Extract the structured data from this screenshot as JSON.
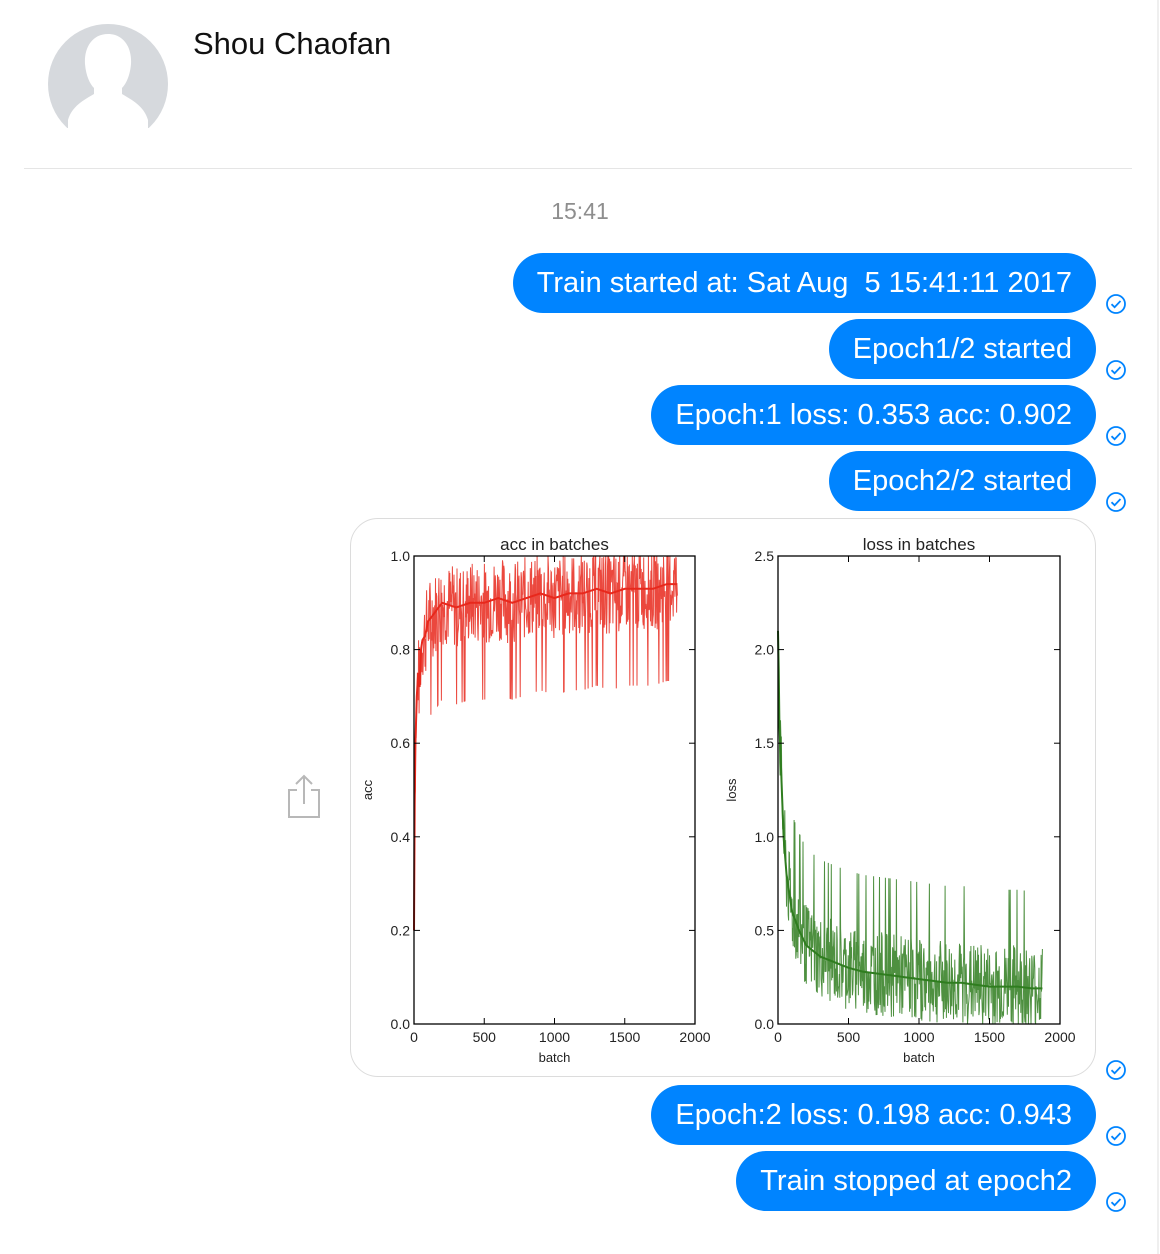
{
  "contact": {
    "name": "Shou Chaofan",
    "avatar_icon": "default-avatar-silhouette"
  },
  "timestamp": "15:41",
  "colors": {
    "bubble": "#0084ff",
    "acc_line": "#e8281c",
    "loss_line": "#2f7d1f",
    "check": "#0084ff"
  },
  "messages": [
    {
      "text": "Train started at: Sat Aug  5 15:41:11 2017"
    },
    {
      "text": "Epoch1/2 started"
    },
    {
      "text": "Epoch:1 loss: 0.353 acc: 0.902"
    },
    {
      "text": "Epoch2/2 started"
    },
    {
      "text": "Epoch:2 loss: 0.198 acc: 0.943"
    },
    {
      "text": "Train stopped at epoch2"
    }
  ],
  "share_icon": "share-icon",
  "chart_data": [
    {
      "type": "line",
      "title": "acc in batches",
      "xlabel": "batch",
      "ylabel": "acc",
      "xlim": [
        0,
        2000
      ],
      "ylim": [
        0.0,
        1.0
      ],
      "xticks": [
        "0",
        "500",
        "1000",
        "1500",
        "2000"
      ],
      "yticks": [
        "0.0",
        "0.2",
        "0.4",
        "0.6",
        "0.8",
        "1.0"
      ],
      "grid": false,
      "series": [
        {
          "x": [
            0,
            5,
            10,
            20,
            30,
            40,
            50,
            60,
            80,
            100,
            150,
            200,
            300,
            400,
            500,
            600,
            700,
            800,
            900,
            1000,
            1100,
            1200,
            1300,
            1400,
            1500,
            1600,
            1700,
            1800,
            1875
          ],
          "y": [
            0.2,
            0.47,
            0.6,
            0.7,
            0.75,
            0.72,
            0.8,
            0.82,
            0.83,
            0.86,
            0.88,
            0.9,
            0.89,
            0.9,
            0.9,
            0.91,
            0.9,
            0.91,
            0.92,
            0.91,
            0.92,
            0.92,
            0.93,
            0.92,
            0.93,
            0.93,
            0.93,
            0.94,
            0.94
          ]
        }
      ]
    },
    {
      "type": "line",
      "title": "loss in batches",
      "xlabel": "batch",
      "ylabel": "loss",
      "xlim": [
        0,
        2000
      ],
      "ylim": [
        0.0,
        2.5
      ],
      "xticks": [
        "0",
        "500",
        "1000",
        "1500",
        "2000"
      ],
      "yticks": [
        "0.0",
        "0.5",
        "1.0",
        "1.5",
        "2.0",
        "2.5"
      ],
      "grid": false,
      "series": [
        {
          "x": [
            0,
            5,
            10,
            20,
            30,
            40,
            60,
            80,
            100,
            150,
            200,
            300,
            400,
            500,
            600,
            700,
            800,
            900,
            1000,
            1100,
            1200,
            1300,
            1400,
            1500,
            1600,
            1700,
            1800,
            1875
          ],
          "y": [
            2.1,
            1.9,
            1.6,
            1.4,
            1.2,
            1.0,
            0.8,
            0.7,
            0.6,
            0.5,
            0.42,
            0.36,
            0.33,
            0.3,
            0.28,
            0.27,
            0.26,
            0.25,
            0.24,
            0.23,
            0.22,
            0.22,
            0.21,
            0.2,
            0.2,
            0.2,
            0.19,
            0.19
          ]
        }
      ]
    }
  ]
}
